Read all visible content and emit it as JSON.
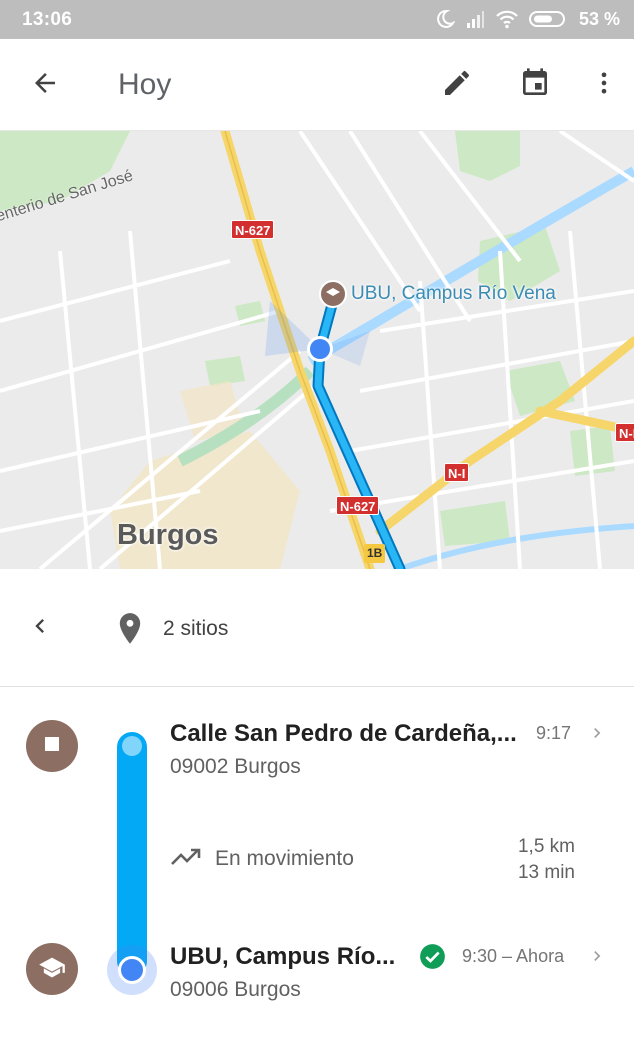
{
  "status_bar": {
    "time": "13:06",
    "battery": "53 %",
    "icons": [
      "moon-icon",
      "signal-icon",
      "wifi-icon",
      "battery-icon"
    ]
  },
  "app_bar": {
    "title": "Hoy",
    "icons": [
      "back-arrow-icon",
      "edit-pencil-icon",
      "calendar-icon",
      "more-vert-icon"
    ]
  },
  "map": {
    "city_label": "Burgos",
    "street_label": "enterio de San José",
    "poi_label": "UBU, Campus Río Vena",
    "road_shields": [
      "N-627",
      "N-627",
      "N-I",
      "N-I",
      "1B"
    ]
  },
  "sites_bar": {
    "label": "2 sitios"
  },
  "timeline": {
    "start": {
      "name": "Calle San Pedro de Cardeña,...",
      "address": "09002 Burgos",
      "time": "9:17",
      "icon": "stop-icon"
    },
    "movement": {
      "label": "En movimiento",
      "distance": "1,5 km",
      "duration": "13 min",
      "icon": "trending-icon"
    },
    "end": {
      "name": "UBU, Campus Río...",
      "address": "09006 Burgos",
      "time": "9:30 – Ahora",
      "icon": "school-icon",
      "status": "check-circle-icon"
    }
  },
  "colors": {
    "route": "#03a9f4",
    "place_icon": "#8d6e63",
    "check": "#0f9d58",
    "location_dot": "#4285f4"
  }
}
